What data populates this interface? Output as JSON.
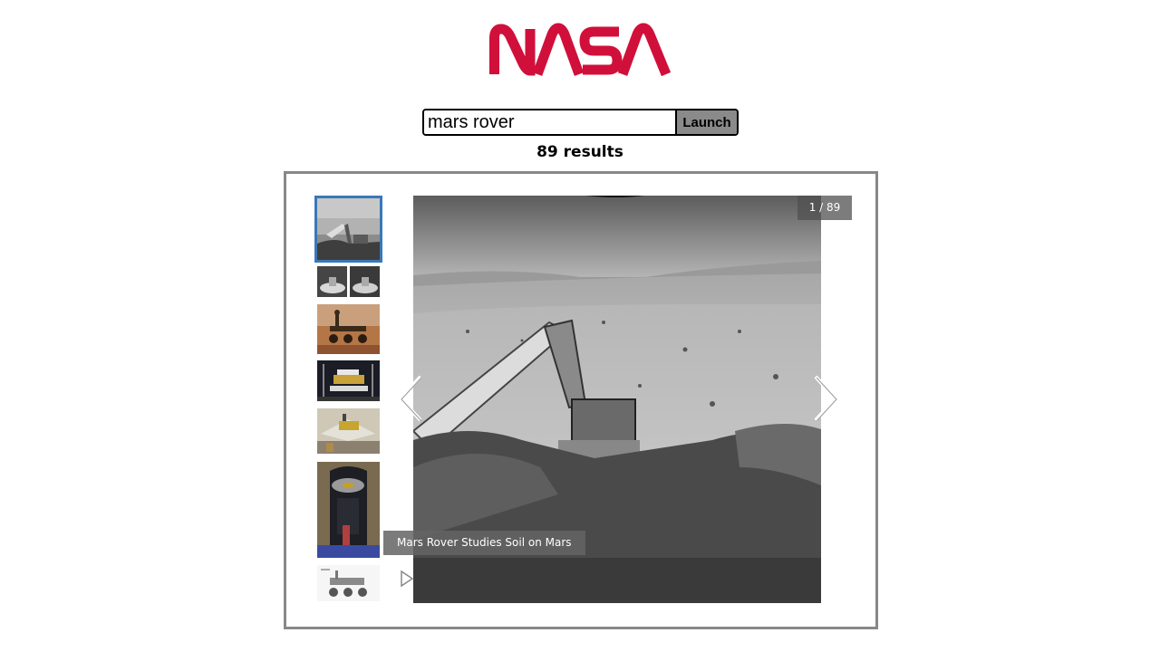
{
  "header": {
    "logo_text": "NASA",
    "logo_color": "#d0103a"
  },
  "search": {
    "value": "mars rover",
    "button_label": "Launch"
  },
  "results": {
    "count_label": "89 results"
  },
  "gallery": {
    "counter": "1 / 89",
    "caption": "Mars Rover Studies Soil on Mars",
    "active_thumb_border": "#3a78b8",
    "thumbnails": [
      {
        "name": "thumb-rover-arm-grayscale"
      },
      {
        "name": "thumb-lander-comparison"
      },
      {
        "name": "thumb-rover-on-mars-red"
      },
      {
        "name": "thumb-rover-assembly"
      },
      {
        "name": "thumb-lander-petals"
      },
      {
        "name": "thumb-spacecraft-cleanroom"
      },
      {
        "name": "thumb-rover-diagram"
      }
    ]
  },
  "icons": {
    "prev": "chevron-left-icon",
    "next": "chevron-right-icon",
    "play": "play-icon"
  }
}
